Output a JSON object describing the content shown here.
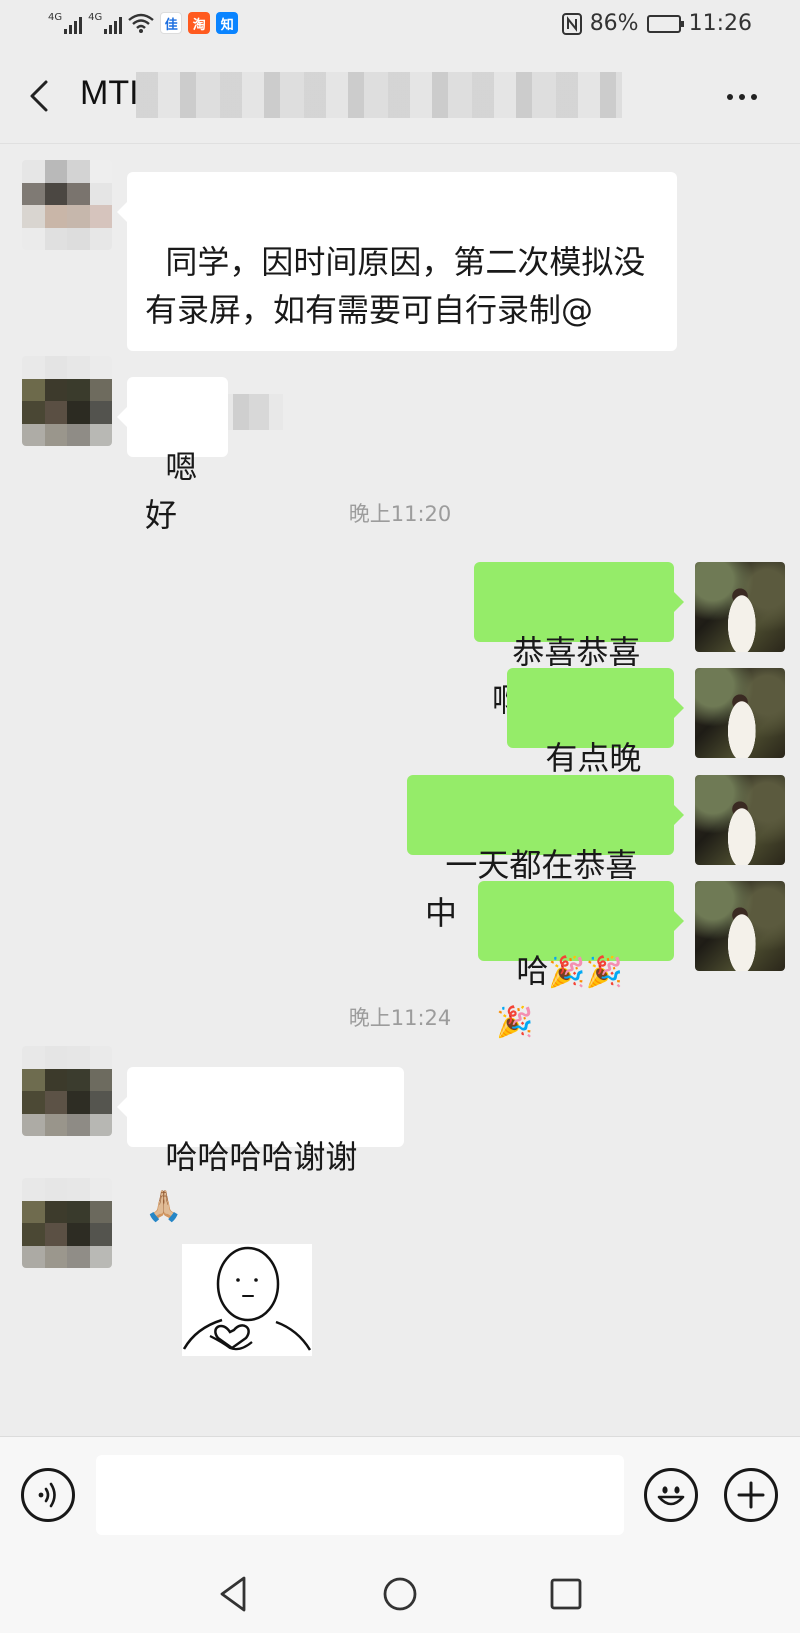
{
  "status_bar": {
    "signal1_label": "4G",
    "signal2_label": "4G",
    "app_icons": [
      {
        "name": "app-icon-blue",
        "glyph": "佳",
        "color": "#1e6fe0"
      },
      {
        "name": "app-icon-orange",
        "glyph": "淘",
        "color": "#ff5a1f"
      },
      {
        "name": "app-icon-zhihu",
        "glyph": "知",
        "color": "#0a84ff"
      }
    ],
    "nfc_icon": "nfc-icon",
    "battery_percent": "86%",
    "battery_level": 0.86,
    "time": "11:26"
  },
  "header": {
    "title_visible": "MTI"
  },
  "messages": {
    "m1": {
      "text": "同学，因时间原因，第二次模拟没\n有录屏，如有需要可自行录制@"
    },
    "m2": {
      "text": "嗯好"
    },
    "ts1": "晚上11:20",
    "m3": {
      "text": "恭喜恭喜啊"
    },
    "m4": {
      "text": "有点晚了"
    },
    "m5": {
      "text": "一天都在恭喜中"
    },
    "m6": {
      "text": "哈",
      "emoji": "🎉🎉🎉"
    },
    "ts2": "晚上11:24",
    "m7": {
      "text": "哈哈哈哈谢谢",
      "emoji": "🙏🏼"
    }
  },
  "colors": {
    "background": "#ededed",
    "outgoing_bubble": "#95ec69",
    "incoming_bubble": "#ffffff",
    "timestamp": "#9c9c9c"
  },
  "input_bar": {
    "voice_icon": "voice-icon",
    "emoji_icon": "smiley-icon",
    "plus_icon": "plus-icon",
    "text_value": ""
  },
  "nav_bar": {
    "back": "nav-back-icon",
    "home": "nav-home-icon",
    "recents": "nav-recents-icon"
  }
}
